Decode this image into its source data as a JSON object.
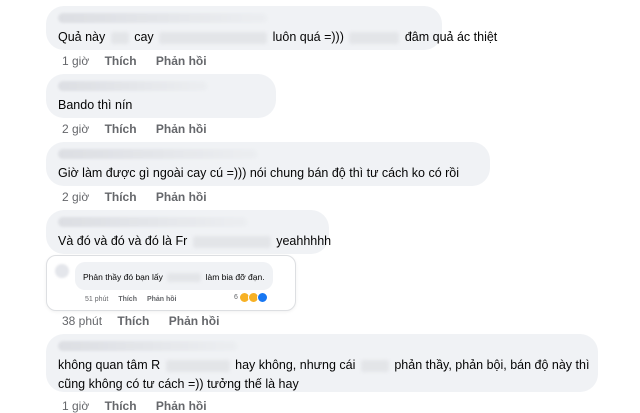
{
  "comments": [
    {
      "text_a": "Quả này",
      "text_b": "cay",
      "text_c": "luôn quá =)))",
      "text_d": "đâm quả ác thiệt",
      "time": "1 giờ",
      "like": "Thích",
      "reply": "Phản hồi"
    },
    {
      "text": "Bando thì nín",
      "time": "2 giờ",
      "like": "Thích",
      "reply": "Phản hồi"
    },
    {
      "text": "Giờ làm được gì ngoài cay cú =))) nói chung bán độ thì tư cách ko có rồi",
      "time": "2 giờ",
      "like": "Thích",
      "reply": "Phản hồi"
    },
    {
      "text_a": "Và đó và đó và đó là Fr",
      "text_b": "yeahhhhh",
      "time": "38 phút",
      "like": "Thích",
      "reply": "Phản hồi",
      "embed": {
        "text_a": "Phản thầy đó bạn lấy",
        "text_b": "làm bia đỡ đạn.",
        "time": "51 phút",
        "like": "Thích",
        "reply": "Phản hồi",
        "reaction_count": "6"
      }
    },
    {
      "line1_a": "không quan tâm R",
      "line1_b": "hay không, nhưng cái",
      "line1_c": "phản thầy, phản bội, bán độ này thì",
      "line2": "cũng không có tư cách =)) tưởng thế là hay",
      "time": "1 giờ",
      "like": "Thích",
      "reply": "Phản hồi"
    }
  ],
  "colors": {
    "bubble": "#f0f2f5",
    "meta": "#65676b",
    "text": "#050505"
  }
}
